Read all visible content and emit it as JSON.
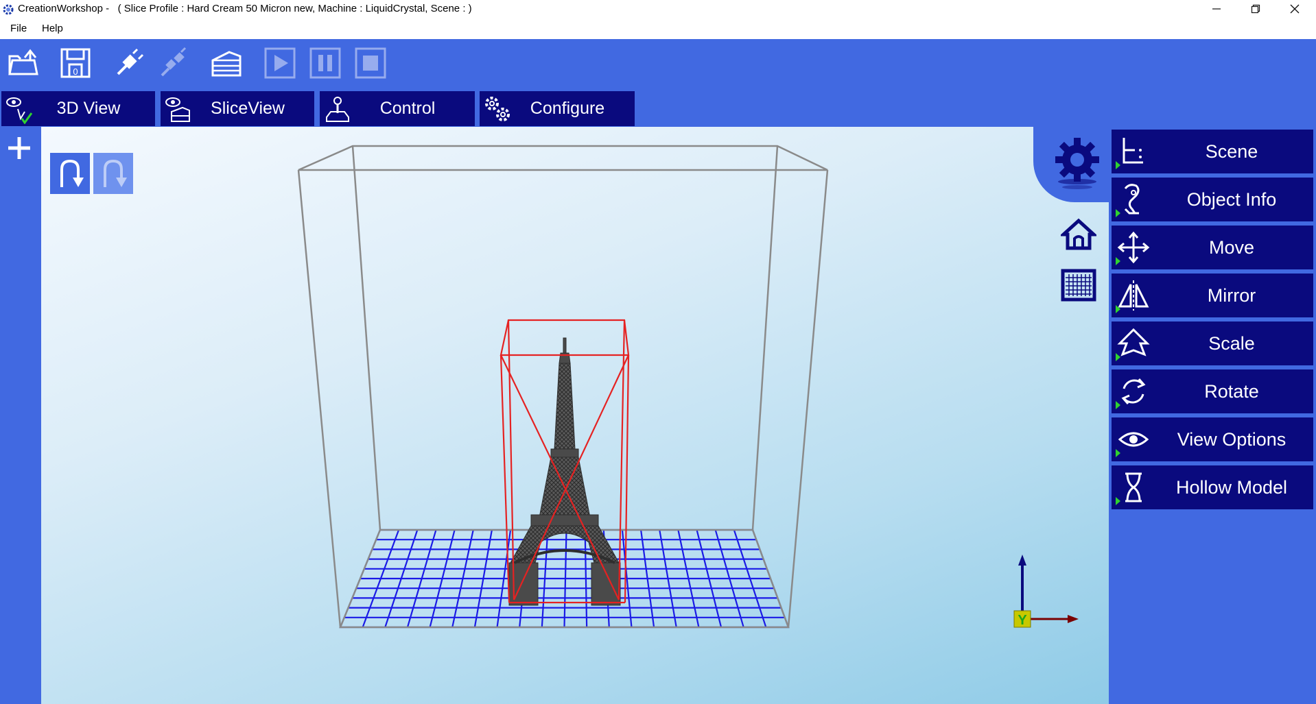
{
  "window": {
    "title": "CreationWorkshop -   ( Slice Profile : Hard Cream 50 Micron new, Machine : LiquidCrystal, Scene : )"
  },
  "menu": [
    "File",
    "Help"
  ],
  "toolbar": {
    "buttons": [
      "open-icon",
      "save-icon",
      "connect-icon",
      "disconnect-icon",
      "slice-icon",
      "play-icon",
      "pause-icon",
      "stop-icon"
    ]
  },
  "tabs": [
    "3D View",
    "SliceView",
    "Control",
    "Configure"
  ],
  "right_panel": [
    "Scene",
    "Object Info",
    "Move",
    "Mirror",
    "Scale",
    "Rotate",
    "View Options",
    "Hollow Model"
  ],
  "axis": {
    "label": "Y"
  },
  "colors": {
    "accent": "#4169e1",
    "button_dark": "#0a0a7e",
    "selection_box": "#e52222",
    "build_grid": "#1a1ae6"
  }
}
